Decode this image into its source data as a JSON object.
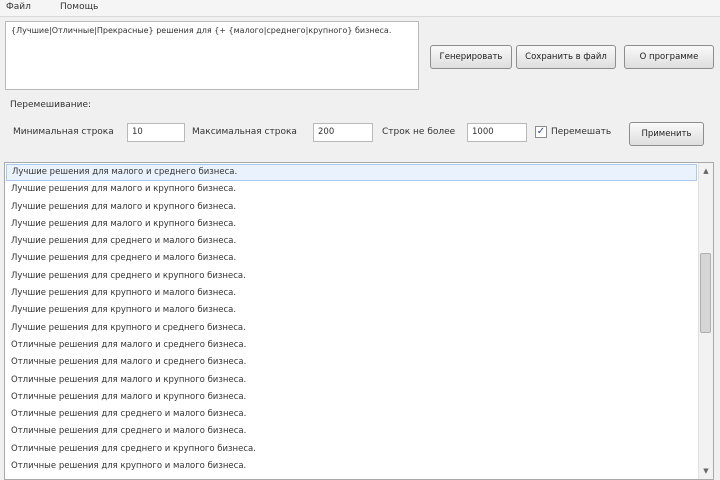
{
  "menu": {
    "file": "Файл",
    "help": "Помощь"
  },
  "template": {
    "text": "{Лучшие|Отличные|Прекрасные} решения для {+ {малого|среднего|крупного} бизнеса."
  },
  "buttons": {
    "generate": "Генерировать",
    "save": "Сохранить в файл",
    "about": "О программе"
  },
  "params": {
    "group_label": "Перемешивание:",
    "min_label": "Минимальная строка",
    "min_value": "10",
    "max_label": "Максимальная строка",
    "max_value": "200",
    "limit_label": "Строк не более",
    "limit_value": "1000",
    "shuffle_label": "Перемешать",
    "shuffle_checked": "✓",
    "apply_button": "Применить"
  },
  "results": [
    "Лучшие решения для малого и среднего бизнеса.",
    "Лучшие решения для малого и крупного бизнеса.",
    "Лучшие решения для малого и крупного бизнеса.",
    "Лучшие решения для малого и крупного бизнеса.",
    "Лучшие решения для среднего и малого бизнеса.",
    "Лучшие решения для среднего и малого бизнеса.",
    "Лучшие решения для среднего и крупного бизнеса.",
    "Лучшие решения для крупного и малого бизнеса.",
    "Лучшие решения для крупного и малого бизнеса.",
    "Лучшие решения для крупного и среднего бизнеса.",
    "Отличные решения для малого и среднего бизнеса.",
    "Отличные решения для малого и среднего бизнеса.",
    "Отличные решения для малого и крупного бизнеса.",
    "Отличные решения для малого и крупного бизнеса.",
    "Отличные решения для среднего и малого бизнеса.",
    "Отличные решения для среднего и малого бизнеса.",
    "Отличные решения для среднего и крупного бизнеса.",
    "Отличные решения для крупного и малого бизнеса."
  ]
}
